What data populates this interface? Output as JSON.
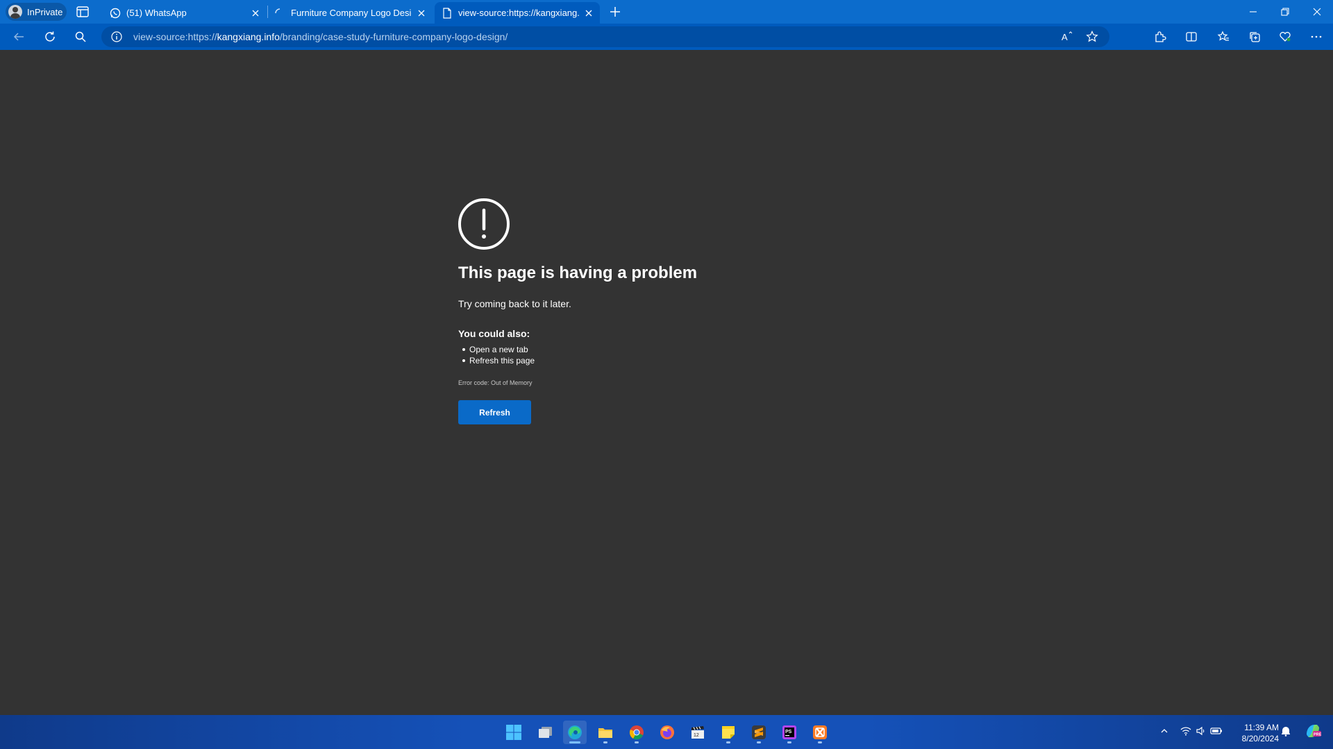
{
  "browser": {
    "profile_label": "InPrivate",
    "tabs": [
      {
        "title": "(51) WhatsApp",
        "favicon": "whatsapp-icon",
        "active": false
      },
      {
        "title": "Furniture Company Logo Design",
        "favicon": "loading-icon",
        "active": false
      },
      {
        "title": "view-source:https://kangxiang.info/branding/case-study-furniture-company-logo-design/",
        "favicon": "page-icon",
        "active": true
      }
    ],
    "address": {
      "prefix": "view-source:https://",
      "host": "kangxiang.info",
      "path": "/branding/case-study-furniture-company-logo-design/"
    },
    "colors": {
      "accent": "#0c6ccc",
      "toolbar": "#005bbd",
      "content_bg": "#333333"
    }
  },
  "error_page": {
    "icon": "exclamation-circle-icon",
    "title": "This page is having a problem",
    "subtitle": "Try coming back to it later.",
    "also_heading": "You could also:",
    "suggestions": [
      "Open a new tab",
      "Refresh this page"
    ],
    "error_code": "Error code: Out of Memory",
    "refresh_label": "Refresh",
    "button_color": "#0a6ac8"
  },
  "taskbar": {
    "apps": [
      "windows-start-icon",
      "task-view-icon",
      "edge-icon",
      "file-explorer-icon",
      "chrome-icon",
      "firefox-icon",
      "clapperboard-app-icon",
      "sticky-notes-icon",
      "sublime-text-icon",
      "phpstorm-icon",
      "xampp-icon"
    ],
    "clock": {
      "time": "11:39 AM",
      "date": "8/20/2024"
    }
  }
}
